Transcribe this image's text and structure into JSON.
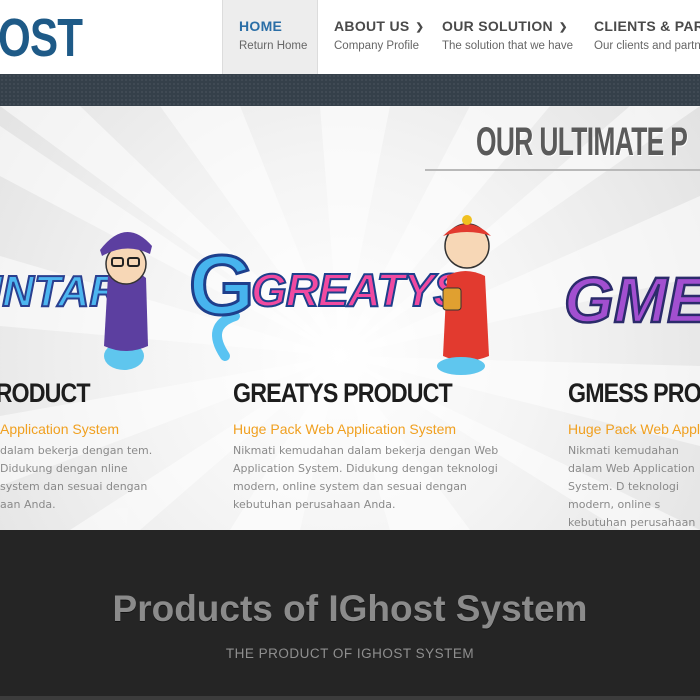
{
  "header": {
    "logo_text": "OST",
    "nav": [
      {
        "title": "HOME",
        "sub": "Return Home"
      },
      {
        "title": "ABOUT US",
        "sub": "Company Profile"
      },
      {
        "title": "OUR SOLUTION",
        "sub": "The solution that we have"
      },
      {
        "title": "CLIENTS & PARTNE",
        "sub": "Our clients and partne"
      }
    ]
  },
  "slider": {
    "title": "OUR ULTIMATE P",
    "products": [
      {
        "logo_text": "INTAR",
        "name": "PRODUCT",
        "tagline": "Application System",
        "desc": "dalam bekerja dengan tem.  Didukung dengan nline system dan sesuai dengan aan Anda."
      },
      {
        "logo_text": "GREATYS",
        "name": "GREATYS PRODUCT",
        "tagline": "Huge Pack Web Application System",
        "desc": "Nikmati kemudahan dalam bekerja dengan Web Application System.  Didukung dengan teknologi modern, online system dan sesuai dengan kebutuhan perusahaan Anda."
      },
      {
        "logo_text": "GME",
        "name": "GMESS PRODU",
        "tagline": "Huge Pack Web Appl",
        "desc": "Nikmati kemudahan dalam Web Application System.  D teknologi modern, online s kebutuhan perusahaan An"
      }
    ]
  },
  "footer": {
    "title": "Products of IGhost System",
    "subtitle": "THE PRODUCT OF IGHOST SYSTEM"
  },
  "colors": {
    "brand_blue": "#1e5a87",
    "accent_orange": "#f0a020",
    "nav_active": "#2a6ea6",
    "dark_band": "#35404a",
    "footer_bg": "#252525"
  }
}
